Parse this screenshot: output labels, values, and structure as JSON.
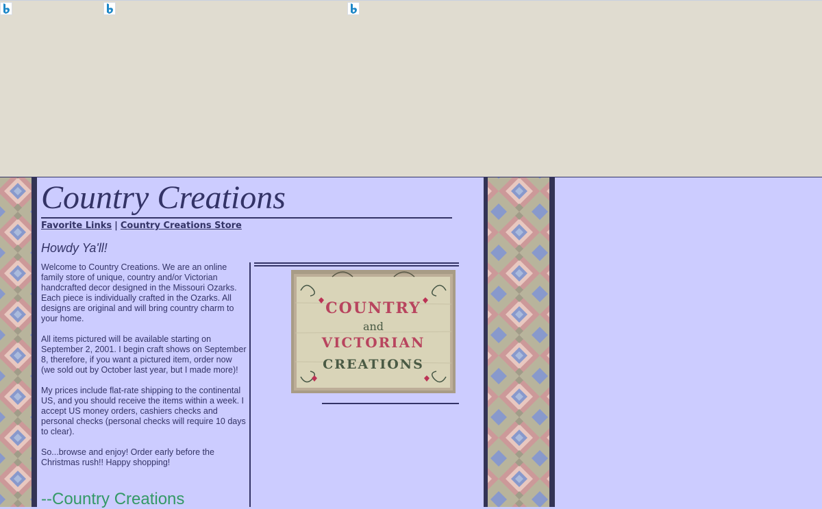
{
  "site": {
    "title": "Country Creations",
    "nav": {
      "links": [
        "Favorite Links",
        "Country Creations Store"
      ],
      "separator": "|"
    },
    "greeting": "Howdy Ya'll!",
    "intro_paragraphs": [
      "Welcome to Country Creations. We are an online family store of unique, country and/or Victorian handcrafted decor designed in the Missouri Ozarks. Each piece is individually crafted in the Ozarks. All designs are original and will bring country charm to your home.",
      "All items pictured will be available starting on September 2, 2001. I begin craft shows on September 8, therefore, if you want a pictured item, order now (we sold out by October last year, but I made more)!",
      "My prices include flat-rate shipping to the continental US, and you should receive the items within a week. I accept US money orders, cashiers checks and personal checks (personal checks will require 10 days to clear).",
      "So...browse and enjoy! Order early before the Christmas rush!! Happy shopping!"
    ],
    "signature": "--Country Creations"
  },
  "sign_image": {
    "lines": [
      "COUNTRY",
      "and",
      "VICTORIAN",
      "CREATIONS"
    ]
  },
  "colors": {
    "page_background": "#ccccff",
    "top_band": "#e0dcd0",
    "text": "#333366",
    "signature": "#339966",
    "quilt": [
      "#cc9999",
      "#8899cc",
      "#b8b49c",
      "#e8c8c0",
      "#aabbdd",
      "#333355"
    ]
  },
  "icons": [
    "bing-b-icon",
    "bing-b-icon",
    "bing-b-icon"
  ]
}
